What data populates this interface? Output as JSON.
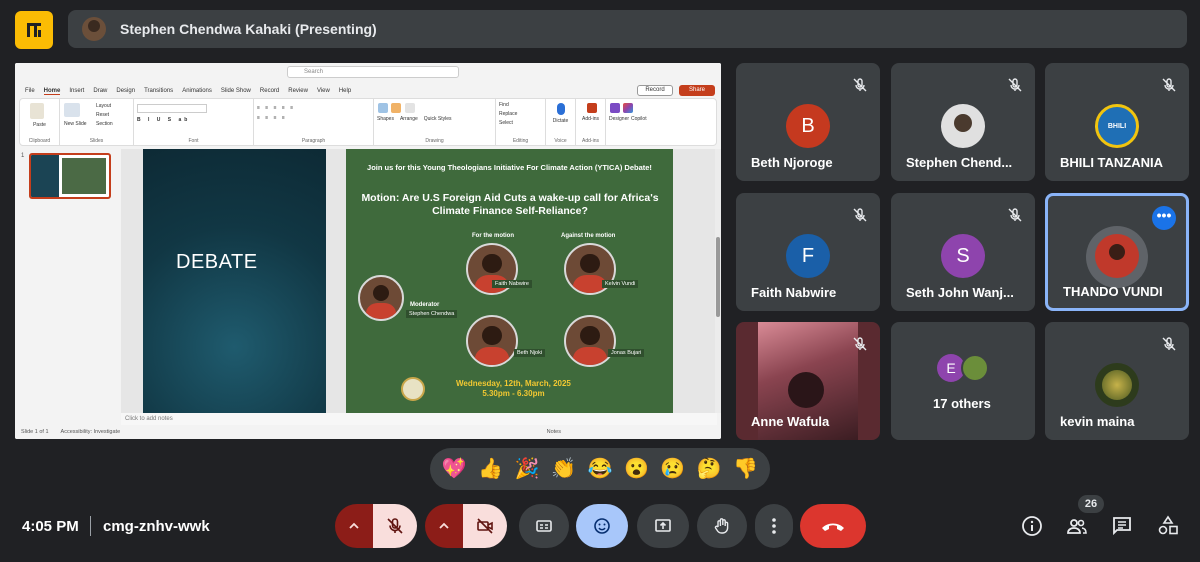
{
  "header": {
    "presenter_label": "Stephen Chendwa Kahaki (Presenting)"
  },
  "slide": {
    "app_search_placeholder": "Search",
    "menu": [
      "File",
      "Home",
      "Insert",
      "Draw",
      "Design",
      "Transitions",
      "Animations",
      "Slide Show",
      "Record",
      "Review",
      "View",
      "Help"
    ],
    "record_label": "Record",
    "share_label": "Share",
    "ribbon_groups": [
      "Clipboard",
      "Slides",
      "Font",
      "Paragraph",
      "Drawing",
      "Editing",
      "Voice",
      "Add-ins"
    ],
    "ribbon_buttons": {
      "paste": "Paste",
      "new_slide": "New Slide",
      "layout": "Layout",
      "reset": "Reset",
      "section": "Section",
      "shapes": "Shapes",
      "arrange": "Arrange",
      "quick_styles": "Quick Styles",
      "find": "Find",
      "replace": "Replace",
      "select": "Select",
      "dictate": "Dictate",
      "addins": "Add-ins",
      "designer": "Designer",
      "copilot": "Copilot"
    },
    "thumb_number": "1",
    "left_title": "DEBATE",
    "top_line": "Join us for this Young Theologians Initiative For Climate Action (YTICA) Debate!",
    "motion": "Motion: Are U.S Foreign Aid Cuts a wake-up call for Africa's Climate Finance Self-Reliance?",
    "for_label": "For the motion",
    "against_label": "Against the motion",
    "moderator_label": "Moderator",
    "moderator_name": "Stephen Chendwa",
    "speakers": [
      "Faith Nabwire",
      "Kelvin Vundi",
      "Beth Njoki",
      "Jonas Bujari"
    ],
    "date_line": "Wednesday, 12th, March, 2025",
    "time_line": "5.30pm - 6.30pm",
    "notes_placeholder": "Click to add notes",
    "status_left": "Slide 1 of 1",
    "status_access": "Accessibility: Investigate",
    "status_notes": "Notes"
  },
  "participants": [
    {
      "name": "Beth Njoroge",
      "initial": "B",
      "color": "#c5391f"
    },
    {
      "name": "Stephen Chend...",
      "initial": "",
      "color": "#4a3a2e"
    },
    {
      "name": "BHILI TANZANIA",
      "initial": "",
      "color": "#1f6fb5"
    },
    {
      "name": "Faith Nabwire",
      "initial": "F",
      "color": "#1a5fa8"
    },
    {
      "name": "Seth John Wanj...",
      "initial": "S",
      "color": "#8e44ad"
    },
    {
      "name": "THANDO VUNDI",
      "initial": "",
      "color": "#c0392b"
    },
    {
      "name": "Anne Wafula",
      "initial": "",
      "color": "#7a2d38"
    },
    {
      "name": "17 others",
      "initial": "E",
      "color": "#8e44ad"
    },
    {
      "name": "kevin maina",
      "initial": "",
      "color": "#2d3b1c"
    }
  ],
  "reactions": [
    "💖",
    "👍",
    "🎉",
    "👏",
    "😂",
    "😮",
    "😢",
    "🤔",
    "👎"
  ],
  "footer": {
    "time": "4:05 PM",
    "meeting_code": "cmg-znhv-wwk",
    "people_count": "26"
  }
}
